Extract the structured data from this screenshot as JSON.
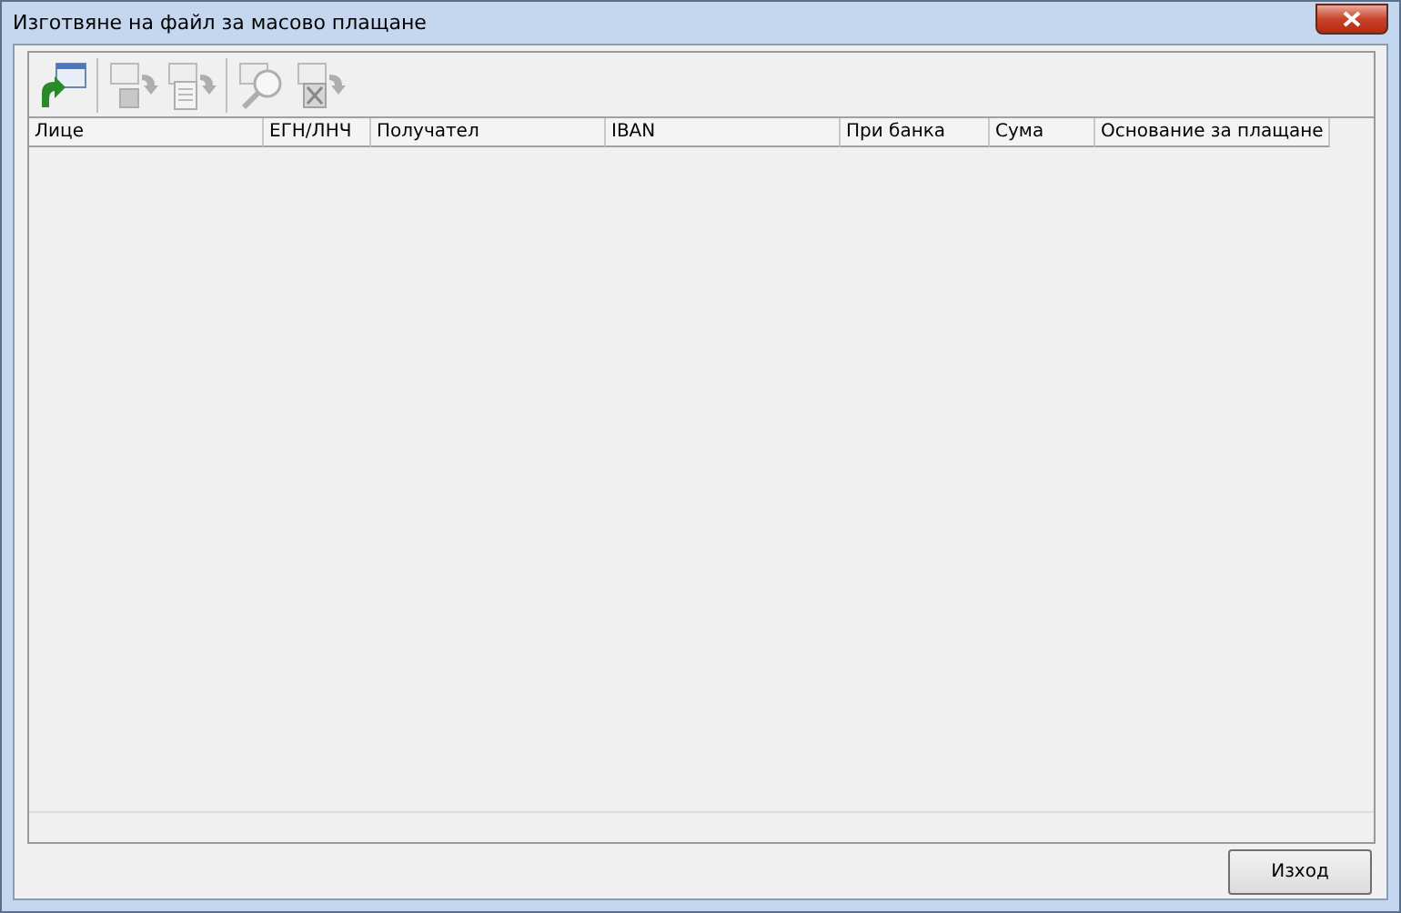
{
  "window": {
    "title": "Изготвяне на файл за масово плащане"
  },
  "toolbar": [
    {
      "kind": "import",
      "disabled": false
    },
    {
      "kind": "save",
      "disabled": true
    },
    {
      "kind": "document",
      "disabled": true
    },
    {
      "kind": "search",
      "disabled": true
    },
    {
      "kind": "excel",
      "disabled": true
    }
  ],
  "table": {
    "columns": [
      "Лице",
      "ЕГН/ЛНЧ",
      "Получател",
      "IBAN",
      "При банка",
      "Сума",
      "Основание за плащане"
    ]
  },
  "buttons": [
    {
      "label": "Изход"
    }
  ]
}
